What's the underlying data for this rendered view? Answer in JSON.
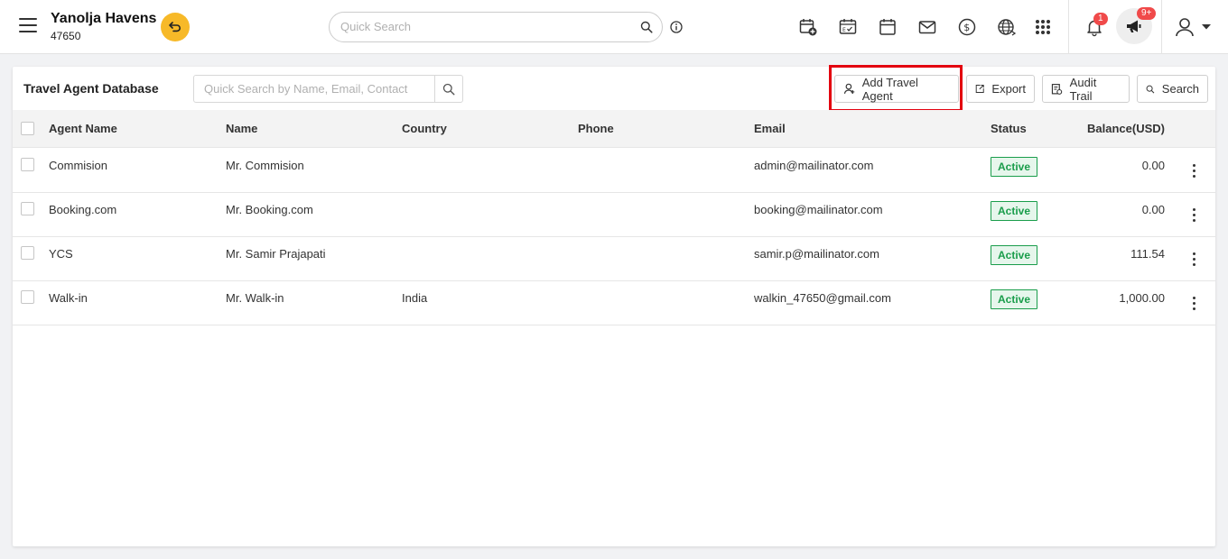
{
  "header": {
    "hotel_name": "Yanolja Havens",
    "hotel_id": "47650",
    "search_placeholder": "Quick Search",
    "notification_count": "1",
    "announcement_count": "9+",
    "icons": [
      "menu-icon",
      "switch-property-icon",
      "search-icon",
      "info-icon",
      "add-reservation-icon",
      "night-audit-icon",
      "calendar-icon",
      "mail-icon",
      "dollar-icon",
      "globe-icon",
      "apps-grid-icon",
      "bell-icon",
      "megaphone-icon",
      "user-icon",
      "caret-down-icon"
    ]
  },
  "page": {
    "title": "Travel Agent Database",
    "search_placeholder": "Quick Search by Name, Email, Contact",
    "buttons": {
      "add": "Add Travel Agent",
      "export": "Export",
      "audit": "Audit Trail",
      "search": "Search"
    }
  },
  "table": {
    "columns": {
      "agent_name": "Agent Name",
      "name": "Name",
      "country": "Country",
      "phone": "Phone",
      "email": "Email",
      "status": "Status",
      "balance": "Balance(USD)"
    },
    "rows": [
      {
        "agent_name": "Commision",
        "name": "Mr. Commision",
        "country": "",
        "phone": "",
        "email": "admin@mailinator.com",
        "status": "Active",
        "balance": "0.00"
      },
      {
        "agent_name": "Booking.com",
        "name": "Mr. Booking.com",
        "country": "",
        "phone": "",
        "email": "booking@mailinator.com",
        "status": "Active",
        "balance": "0.00"
      },
      {
        "agent_name": "YCS",
        "name": "Mr. Samir Prajapati",
        "country": "",
        "phone": "",
        "email": "samir.p@mailinator.com",
        "status": "Active",
        "balance": "111.54"
      },
      {
        "agent_name": "Walk-in",
        "name": "Mr. Walk-in",
        "country": "India",
        "phone": "",
        "email": "walkin_47650@gmail.com",
        "status": "Active",
        "balance": "1,000.00"
      }
    ]
  },
  "colors": {
    "accent_yellow": "#f7b928",
    "status_green": "#1a9d4b",
    "highlight_red": "#e3000f",
    "badge_red": "#f04a4a"
  }
}
